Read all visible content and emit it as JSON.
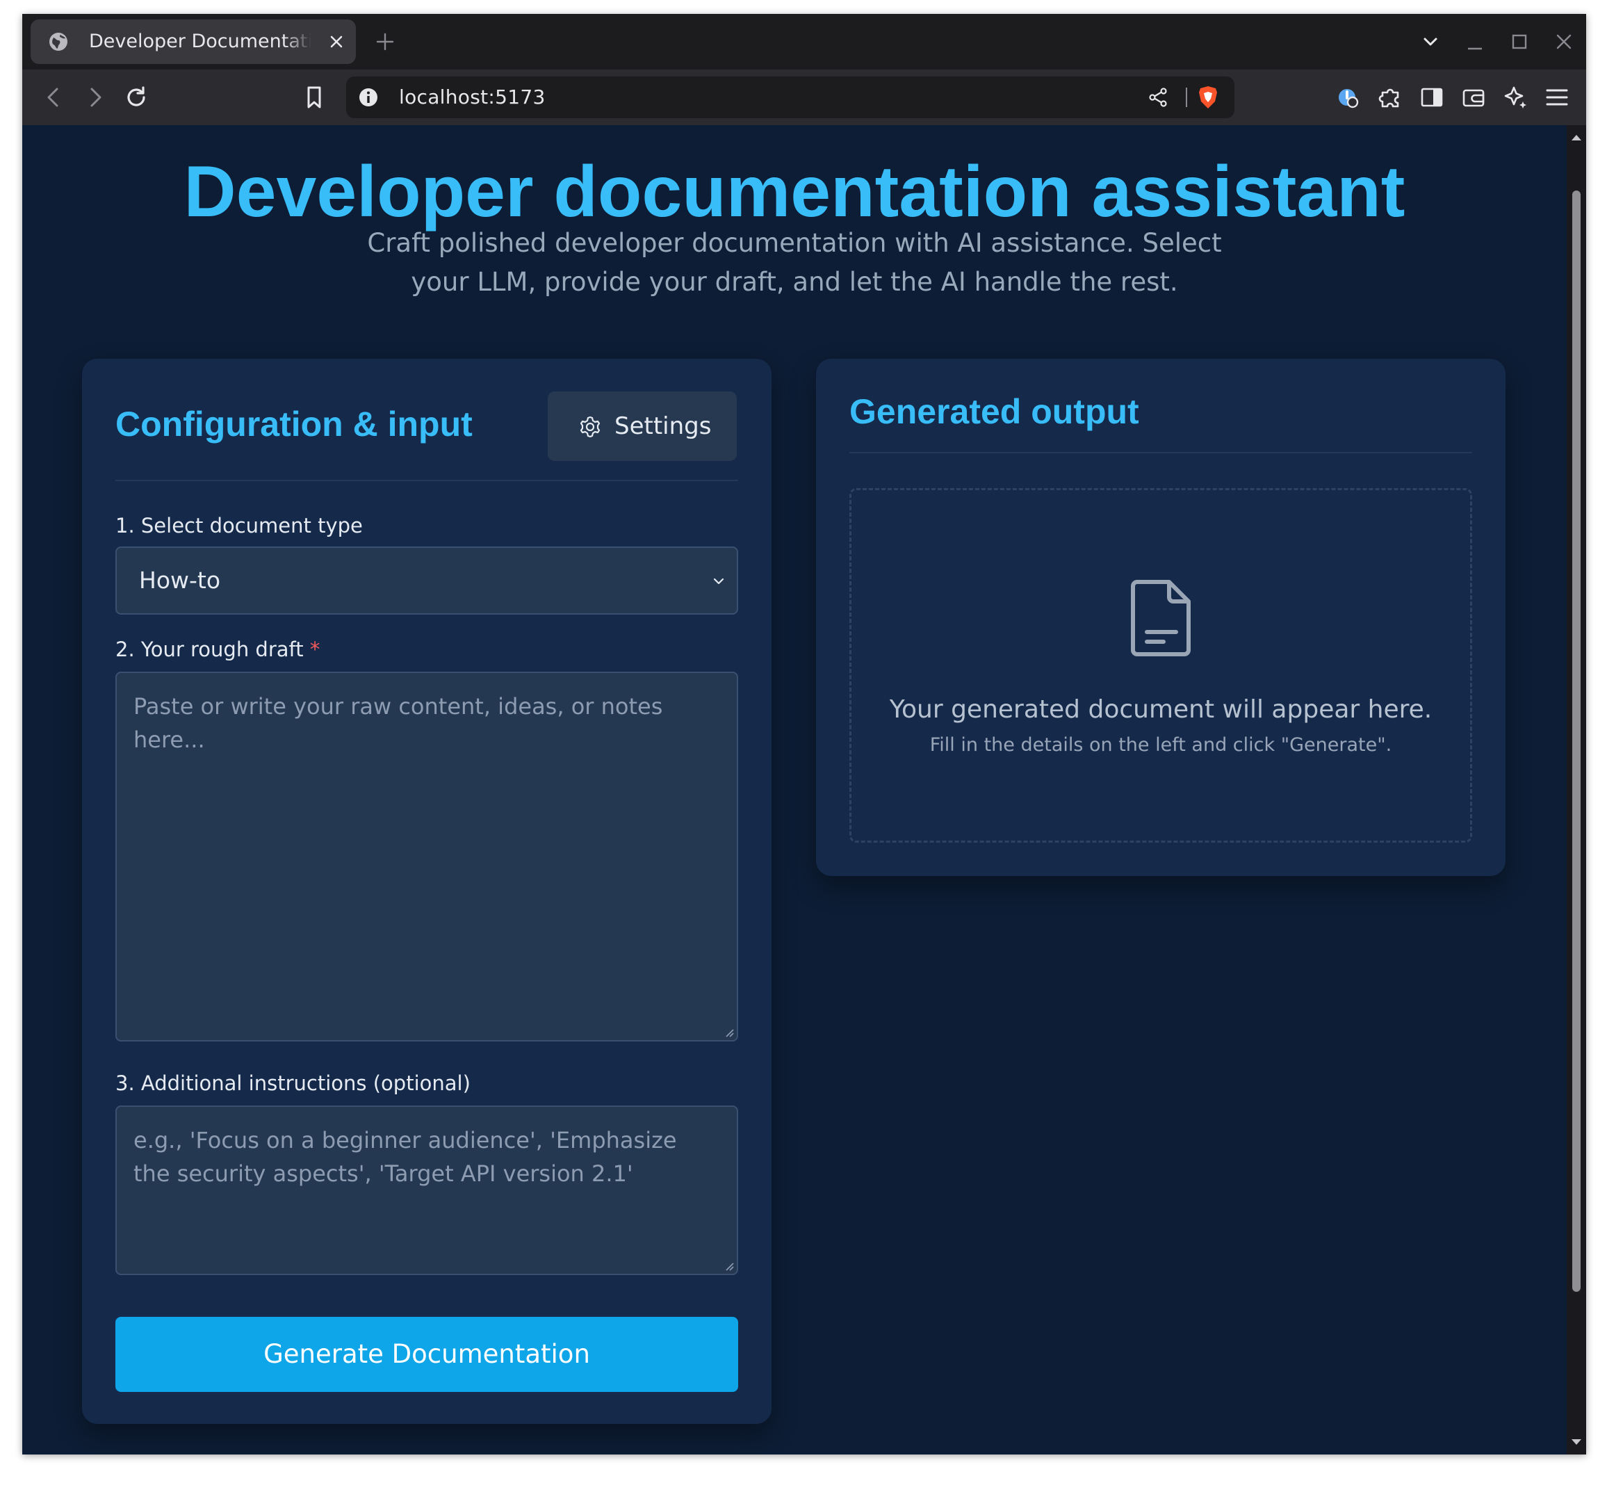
{
  "browser": {
    "tab": {
      "title": "Developer Documentation"
    },
    "url": "localhost:5173"
  },
  "page": {
    "title": "Developer documentation assistant",
    "subtitle": "Craft polished developer documentation with AI assistance. Select your LLM, provide your draft, and let the AI handle the rest."
  },
  "config_panel": {
    "title": "Configuration & input",
    "settings_label": "Settings",
    "doc_type": {
      "label": "1. Select document type",
      "value": "How-to"
    },
    "draft": {
      "label": "2. Your rough draft",
      "required_marker": "*",
      "placeholder": "Paste or write your raw content, ideas, or notes here..."
    },
    "instructions": {
      "label": "3. Additional instructions (optional)",
      "placeholder": "e.g., 'Focus on a beginner audience', 'Emphasize the security aspects', 'Target API version 2.1'"
    },
    "generate_label": "Generate Documentation"
  },
  "output_panel": {
    "title": "Generated output",
    "empty_message": "Your generated document will appear here.",
    "empty_hint": "Fill in the details on the left and click \"Generate\"."
  },
  "colors": {
    "accent": "#38bdf8",
    "button": "#0ea5e9",
    "page_bg": "#0d1d35",
    "card_bg": "#15294a",
    "required": "#f05a5a"
  },
  "icons": [
    "globe-icon",
    "close-icon",
    "plus-icon",
    "chevron-down-icon",
    "minimize-icon",
    "maximize-icon",
    "back-icon",
    "forward-icon",
    "reload-icon",
    "bookmark-icon",
    "info-icon",
    "share-icon",
    "brave-shield-icon",
    "extension-icon",
    "puzzle-icon",
    "sidebar-icon",
    "wallet-icon",
    "leo-icon",
    "menu-icon",
    "gear-icon",
    "document-icon"
  ]
}
